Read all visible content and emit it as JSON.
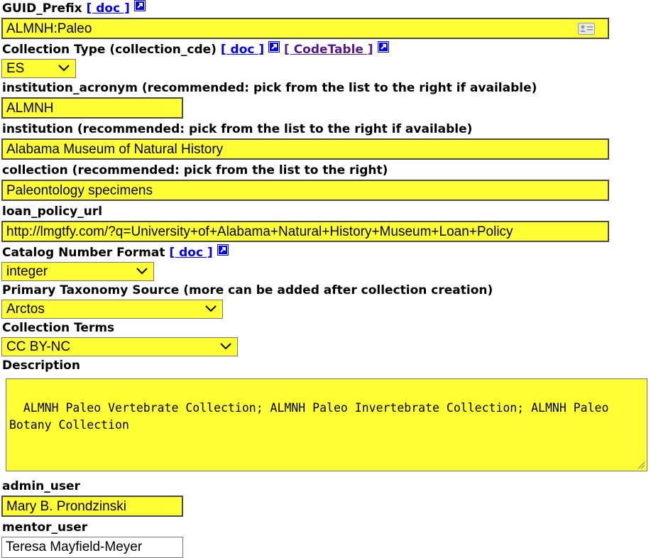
{
  "doc_link": "[ doc ]",
  "codetable_link": "[ CodeTable ]",
  "fields": {
    "guid_prefix": {
      "label": "GUID_Prefix",
      "value": "ALMNH:Paleo"
    },
    "collection_type": {
      "label": "Collection Type (collection_cde)",
      "value": "ES"
    },
    "institution_acronym": {
      "label": "institution_acronym (recommended: pick from the list to the right if available)",
      "value": "ALMNH"
    },
    "institution": {
      "label": "institution (recommended: pick from the list to the right if available)",
      "value": "Alabama Museum of Natural History"
    },
    "collection": {
      "label": "collection (recommended: pick from the list to the right)",
      "value": "Paleontology specimens"
    },
    "loan_policy_url": {
      "label": "loan_policy_url",
      "value": "http://lmgtfy.com/?q=University+of+Alabama+Natural+History+Museum+Loan+Policy"
    },
    "catalog_number_format": {
      "label": "Catalog Number Format",
      "value": "integer"
    },
    "primary_taxonomy_source": {
      "label": "Primary Taxonomy Source (more can be added after collection creation)",
      "value": "Arctos"
    },
    "collection_terms": {
      "label": "Collection Terms",
      "value": "CC BY-NC"
    },
    "description": {
      "label": "Description",
      "value": "ALMNH Paleo Vertebrate Collection; ALMNH Paleo Invertebrate Collection; ALMNH Paleo Botany Collection"
    },
    "admin_user": {
      "label": "admin_user",
      "value": "Mary B. Prondzinski"
    },
    "mentor_user": {
      "label": "mentor_user",
      "value": "Teresa Mayfield-Meyer"
    }
  },
  "colors": {
    "input_bg": "#ffff33",
    "link": "#0000ee",
    "visited_link": "#551a8b"
  }
}
